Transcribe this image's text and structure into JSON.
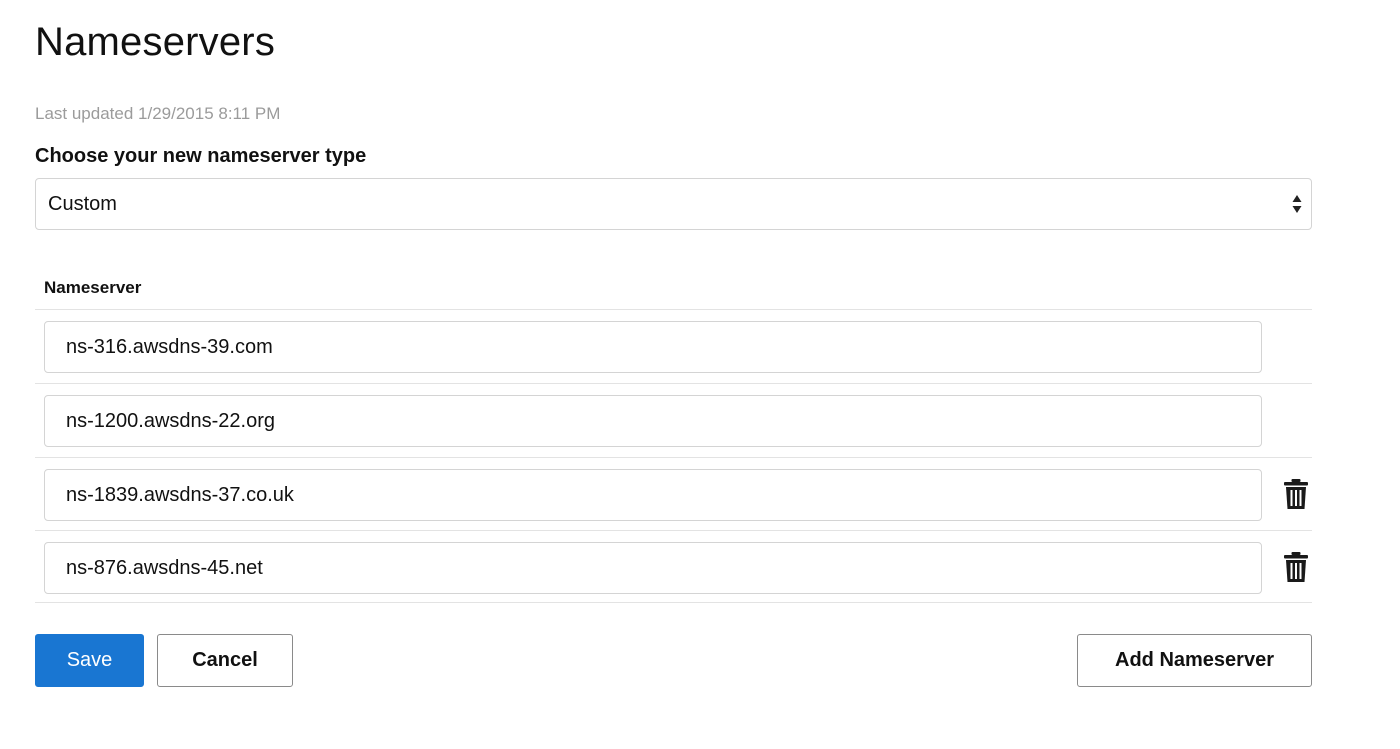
{
  "header": {
    "title": "Nameservers",
    "last_updated": "Last updated 1/29/2015 8:11 PM"
  },
  "type_select": {
    "label": "Choose your new nameserver type",
    "value": "Custom"
  },
  "nameservers": {
    "column_header": "Nameserver",
    "rows": [
      {
        "value": "ns-316.awsdns-39.com",
        "deletable": false
      },
      {
        "value": "ns-1200.awsdns-22.org",
        "deletable": false
      },
      {
        "value": "ns-1839.awsdns-37.co.uk",
        "deletable": true
      },
      {
        "value": "ns-876.awsdns-45.net",
        "deletable": true
      }
    ]
  },
  "actions": {
    "save_label": "Save",
    "cancel_label": "Cancel",
    "add_label": "Add Nameserver"
  },
  "colors": {
    "primary": "#1976d2",
    "muted_text": "#9b9b9b",
    "border": "#d4d4d4"
  },
  "icons": {
    "delete": "trash-icon",
    "select_arrows": "sort-arrows-icon"
  }
}
